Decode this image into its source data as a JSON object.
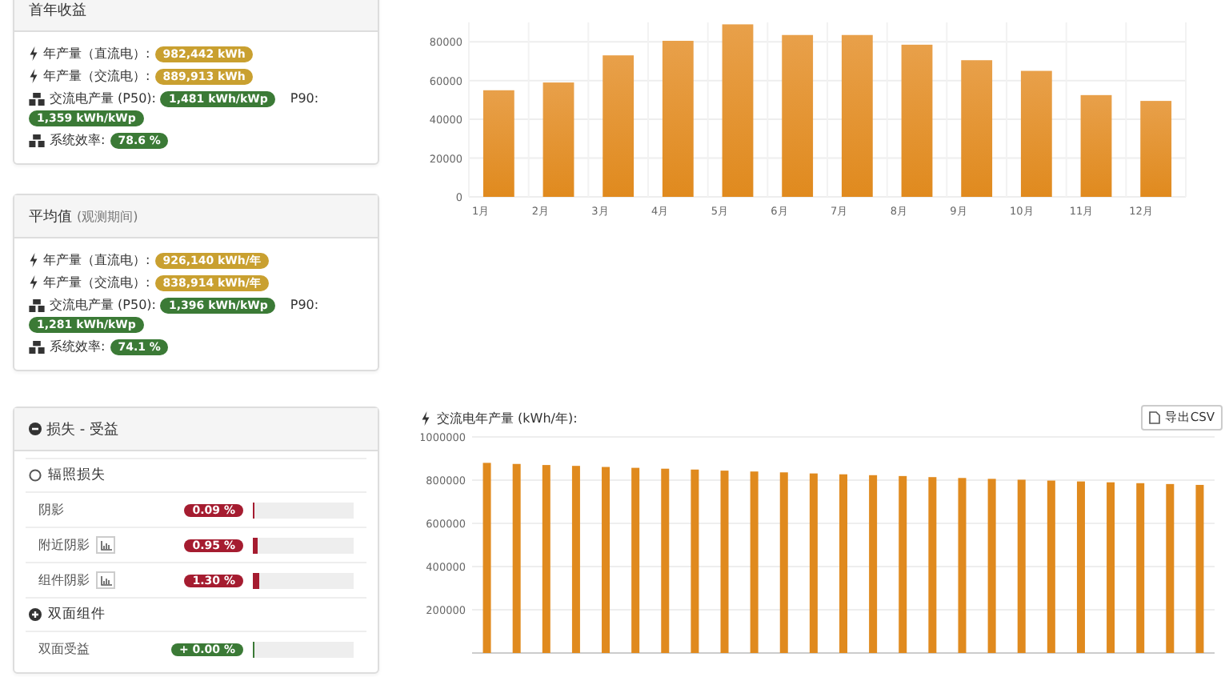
{
  "summary_cards": [
    {
      "title": "首年收益",
      "rows": [
        {
          "kind": "bolt",
          "label": "年产量（直流电）:",
          "value": "982,442 kWh",
          "color": "#c9a030"
        },
        {
          "kind": "bolt",
          "label": "年产量（交流电）:",
          "value": "889,913 kWh",
          "color": "#c9a030"
        },
        {
          "kind": "cubes",
          "label": "交流电产量 (P50):",
          "value": "1,481 kWh/kWp",
          "color": "#3b7a36",
          "p90_label": "P90:",
          "p90_value": "1,359 kWh/kWp"
        },
        {
          "kind": "cubes",
          "label": "系统效率:",
          "value": "78.6 %",
          "color": "#3b7a36"
        }
      ]
    },
    {
      "title": "平均值",
      "subtitle": "(观测期间)",
      "rows": [
        {
          "kind": "bolt",
          "label": "年产量（直流电）:",
          "value": "926,140 kWh/年",
          "color": "#c9a030"
        },
        {
          "kind": "bolt",
          "label": "年产量（交流电）:",
          "value": "838,914 kWh/年",
          "color": "#c9a030"
        },
        {
          "kind": "cubes",
          "label": "交流电产量 (P50):",
          "value": "1,396 kWh/kWp",
          "color": "#3b7a36",
          "p90_label": "P90:",
          "p90_value": "1,281 kWh/kWp"
        },
        {
          "kind": "cubes",
          "label": "系统效率:",
          "value": "74.1 %",
          "color": "#3b7a36"
        }
      ]
    }
  ],
  "loss_card": {
    "title": "损失 - 受益",
    "groups": [
      {
        "kind": "open",
        "title": "辐照损失",
        "rows": [
          {
            "label": "阴影",
            "chart_button": false,
            "value": "0.09 %",
            "color": "#a51c30",
            "level": 0.01
          },
          {
            "label": "附近阴影",
            "chart_button": true,
            "value": "0.95 %",
            "color": "#a51c30",
            "level": 0.05
          },
          {
            "label": "组件阴影",
            "chart_button": true,
            "value": "1.30 %",
            "color": "#a51c30",
            "level": 0.07
          }
        ]
      },
      {
        "kind": "plus",
        "title": "双面组件",
        "rows": [
          {
            "label": "双面受益",
            "chart_button": false,
            "value": "+ 0.00 %",
            "color": "#3b7a36",
            "level": 0
          }
        ]
      }
    ]
  },
  "monthly_chart": {
    "chart_data": {
      "type": "bar",
      "grid": true,
      "categories": [
        "1月",
        "2月",
        "3月",
        "4月",
        "5月",
        "6月",
        "7月",
        "8月",
        "9月",
        "10月",
        "11月",
        "12月"
      ],
      "series": [
        {
          "color": "#e08a1e",
          "values": [
            55000,
            59000,
            73000,
            80500,
            89000,
            83500,
            83500,
            78500,
            70500,
            65000,
            52500,
            49500
          ]
        }
      ],
      "ylim": [
        0,
        90000
      ],
      "yticks": [
        0,
        20000,
        40000,
        60000,
        80000
      ]
    }
  },
  "annual_chart": {
    "title": "交流电年产量 (kWh/年):",
    "export_button": "导出CSV",
    "chart_data": {
      "type": "bar",
      "grid": true,
      "series": [
        {
          "color": "#e08a1e",
          "values": [
            880000,
            875000,
            870000,
            866000,
            861000,
            857000,
            853000,
            849000,
            844000,
            840000,
            836000,
            831000,
            827000,
            823000,
            819000,
            814000,
            810000,
            806000,
            802000,
            798000,
            794000,
            790000,
            786000,
            782000,
            778000
          ]
        }
      ],
      "ylim": [
        0,
        1000000
      ],
      "yticks": [
        200000,
        400000,
        600000,
        800000,
        1000000
      ]
    }
  }
}
